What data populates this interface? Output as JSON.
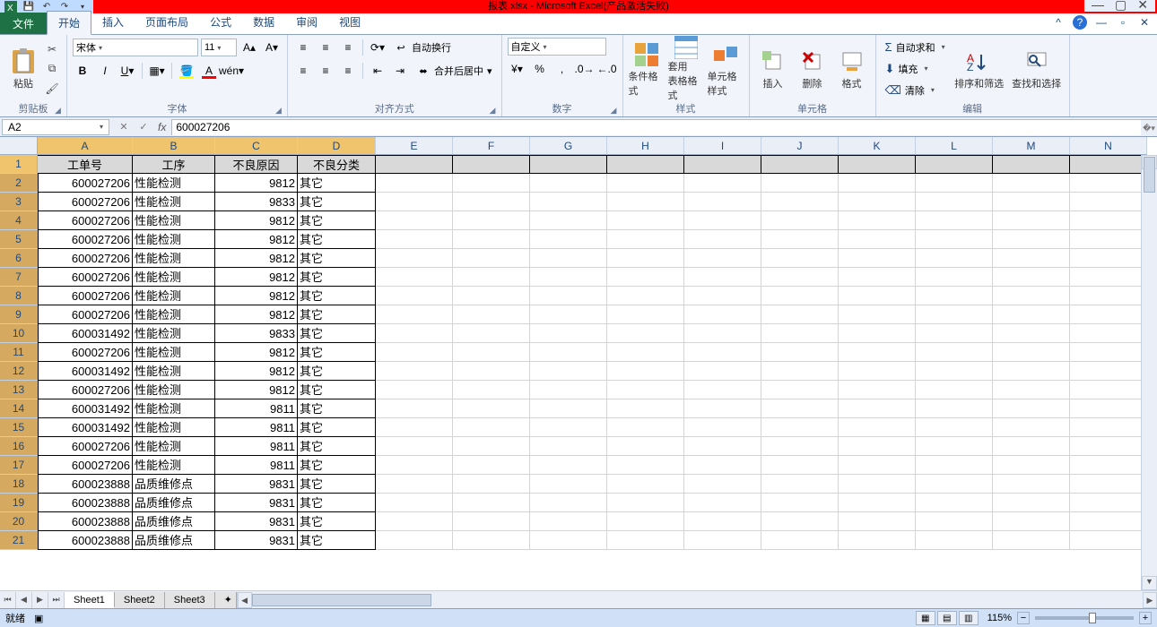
{
  "title": "报表.xlsx - Microsoft Excel(产品激活失败)",
  "qat": [
    "save",
    "undo",
    "redo"
  ],
  "tabs": {
    "file": "文件",
    "items": [
      "开始",
      "插入",
      "页面布局",
      "公式",
      "数据",
      "审阅",
      "视图"
    ],
    "active": 0
  },
  "ribbon": {
    "clipboard": {
      "label": "剪贴板",
      "paste": "粘贴"
    },
    "font": {
      "label": "字体",
      "name": "宋体",
      "size": "11"
    },
    "align": {
      "label": "对齐方式",
      "wrap": "自动换行",
      "merge": "合并后居中"
    },
    "number": {
      "label": "数字",
      "format": "自定义"
    },
    "styles": {
      "label": "样式",
      "cond": "条件格式",
      "table": "套用\n表格格式",
      "cell": "单元格样式"
    },
    "cells": {
      "label": "单元格",
      "insert": "插入",
      "delete": "删除",
      "format": "格式"
    },
    "edit": {
      "label": "编辑",
      "sum": "自动求和",
      "fill": "填充",
      "clear": "清除",
      "sort": "排序和筛选",
      "find": "查找和选择"
    }
  },
  "namebox": "A2",
  "formula": "600027206",
  "columns": [
    "A",
    "B",
    "C",
    "D",
    "E",
    "F",
    "G",
    "H",
    "I",
    "J",
    "K",
    "L",
    "M",
    "N"
  ],
  "dataCols": 4,
  "header": [
    "工单号",
    "工序",
    "不良原因",
    "不良分类"
  ],
  "rows": [
    [
      "600027206",
      "性能检测",
      "9812",
      "其它"
    ],
    [
      "600027206",
      "性能检测",
      "9833",
      "其它"
    ],
    [
      "600027206",
      "性能检测",
      "9812",
      "其它"
    ],
    [
      "600027206",
      "性能检测",
      "9812",
      "其它"
    ],
    [
      "600027206",
      "性能检测",
      "9812",
      "其它"
    ],
    [
      "600027206",
      "性能检测",
      "9812",
      "其它"
    ],
    [
      "600027206",
      "性能检测",
      "9812",
      "其它"
    ],
    [
      "600027206",
      "性能检测",
      "9812",
      "其它"
    ],
    [
      "600031492",
      "性能检测",
      "9833",
      "其它"
    ],
    [
      "600027206",
      "性能检测",
      "9812",
      "其它"
    ],
    [
      "600031492",
      "性能检测",
      "9812",
      "其它"
    ],
    [
      "600027206",
      "性能检测",
      "9812",
      "其它"
    ],
    [
      "600031492",
      "性能检测",
      "9811",
      "其它"
    ],
    [
      "600031492",
      "性能检测",
      "9811",
      "其它"
    ],
    [
      "600027206",
      "性能检测",
      "9811",
      "其它"
    ],
    [
      "600027206",
      "性能检测",
      "9811",
      "其它"
    ],
    [
      "600023888",
      "品质维修点",
      "9831",
      "其它"
    ],
    [
      "600023888",
      "品质维修点",
      "9831",
      "其它"
    ],
    [
      "600023888",
      "品质维修点",
      "9831",
      "其它"
    ],
    [
      "600023888",
      "品质维修点",
      "9831",
      "其它"
    ]
  ],
  "activeRows": [
    1,
    2,
    3,
    4,
    5,
    6,
    7,
    8,
    9,
    10,
    11,
    12,
    13,
    14,
    15,
    16,
    17,
    18,
    19,
    20,
    21
  ],
  "activeCols": [
    "A",
    "B",
    "C",
    "D"
  ],
  "sheets": [
    "Sheet1",
    "Sheet2",
    "Sheet3"
  ],
  "activeSheet": 0,
  "status": {
    "ready": "就绪",
    "zoom": "115%"
  }
}
